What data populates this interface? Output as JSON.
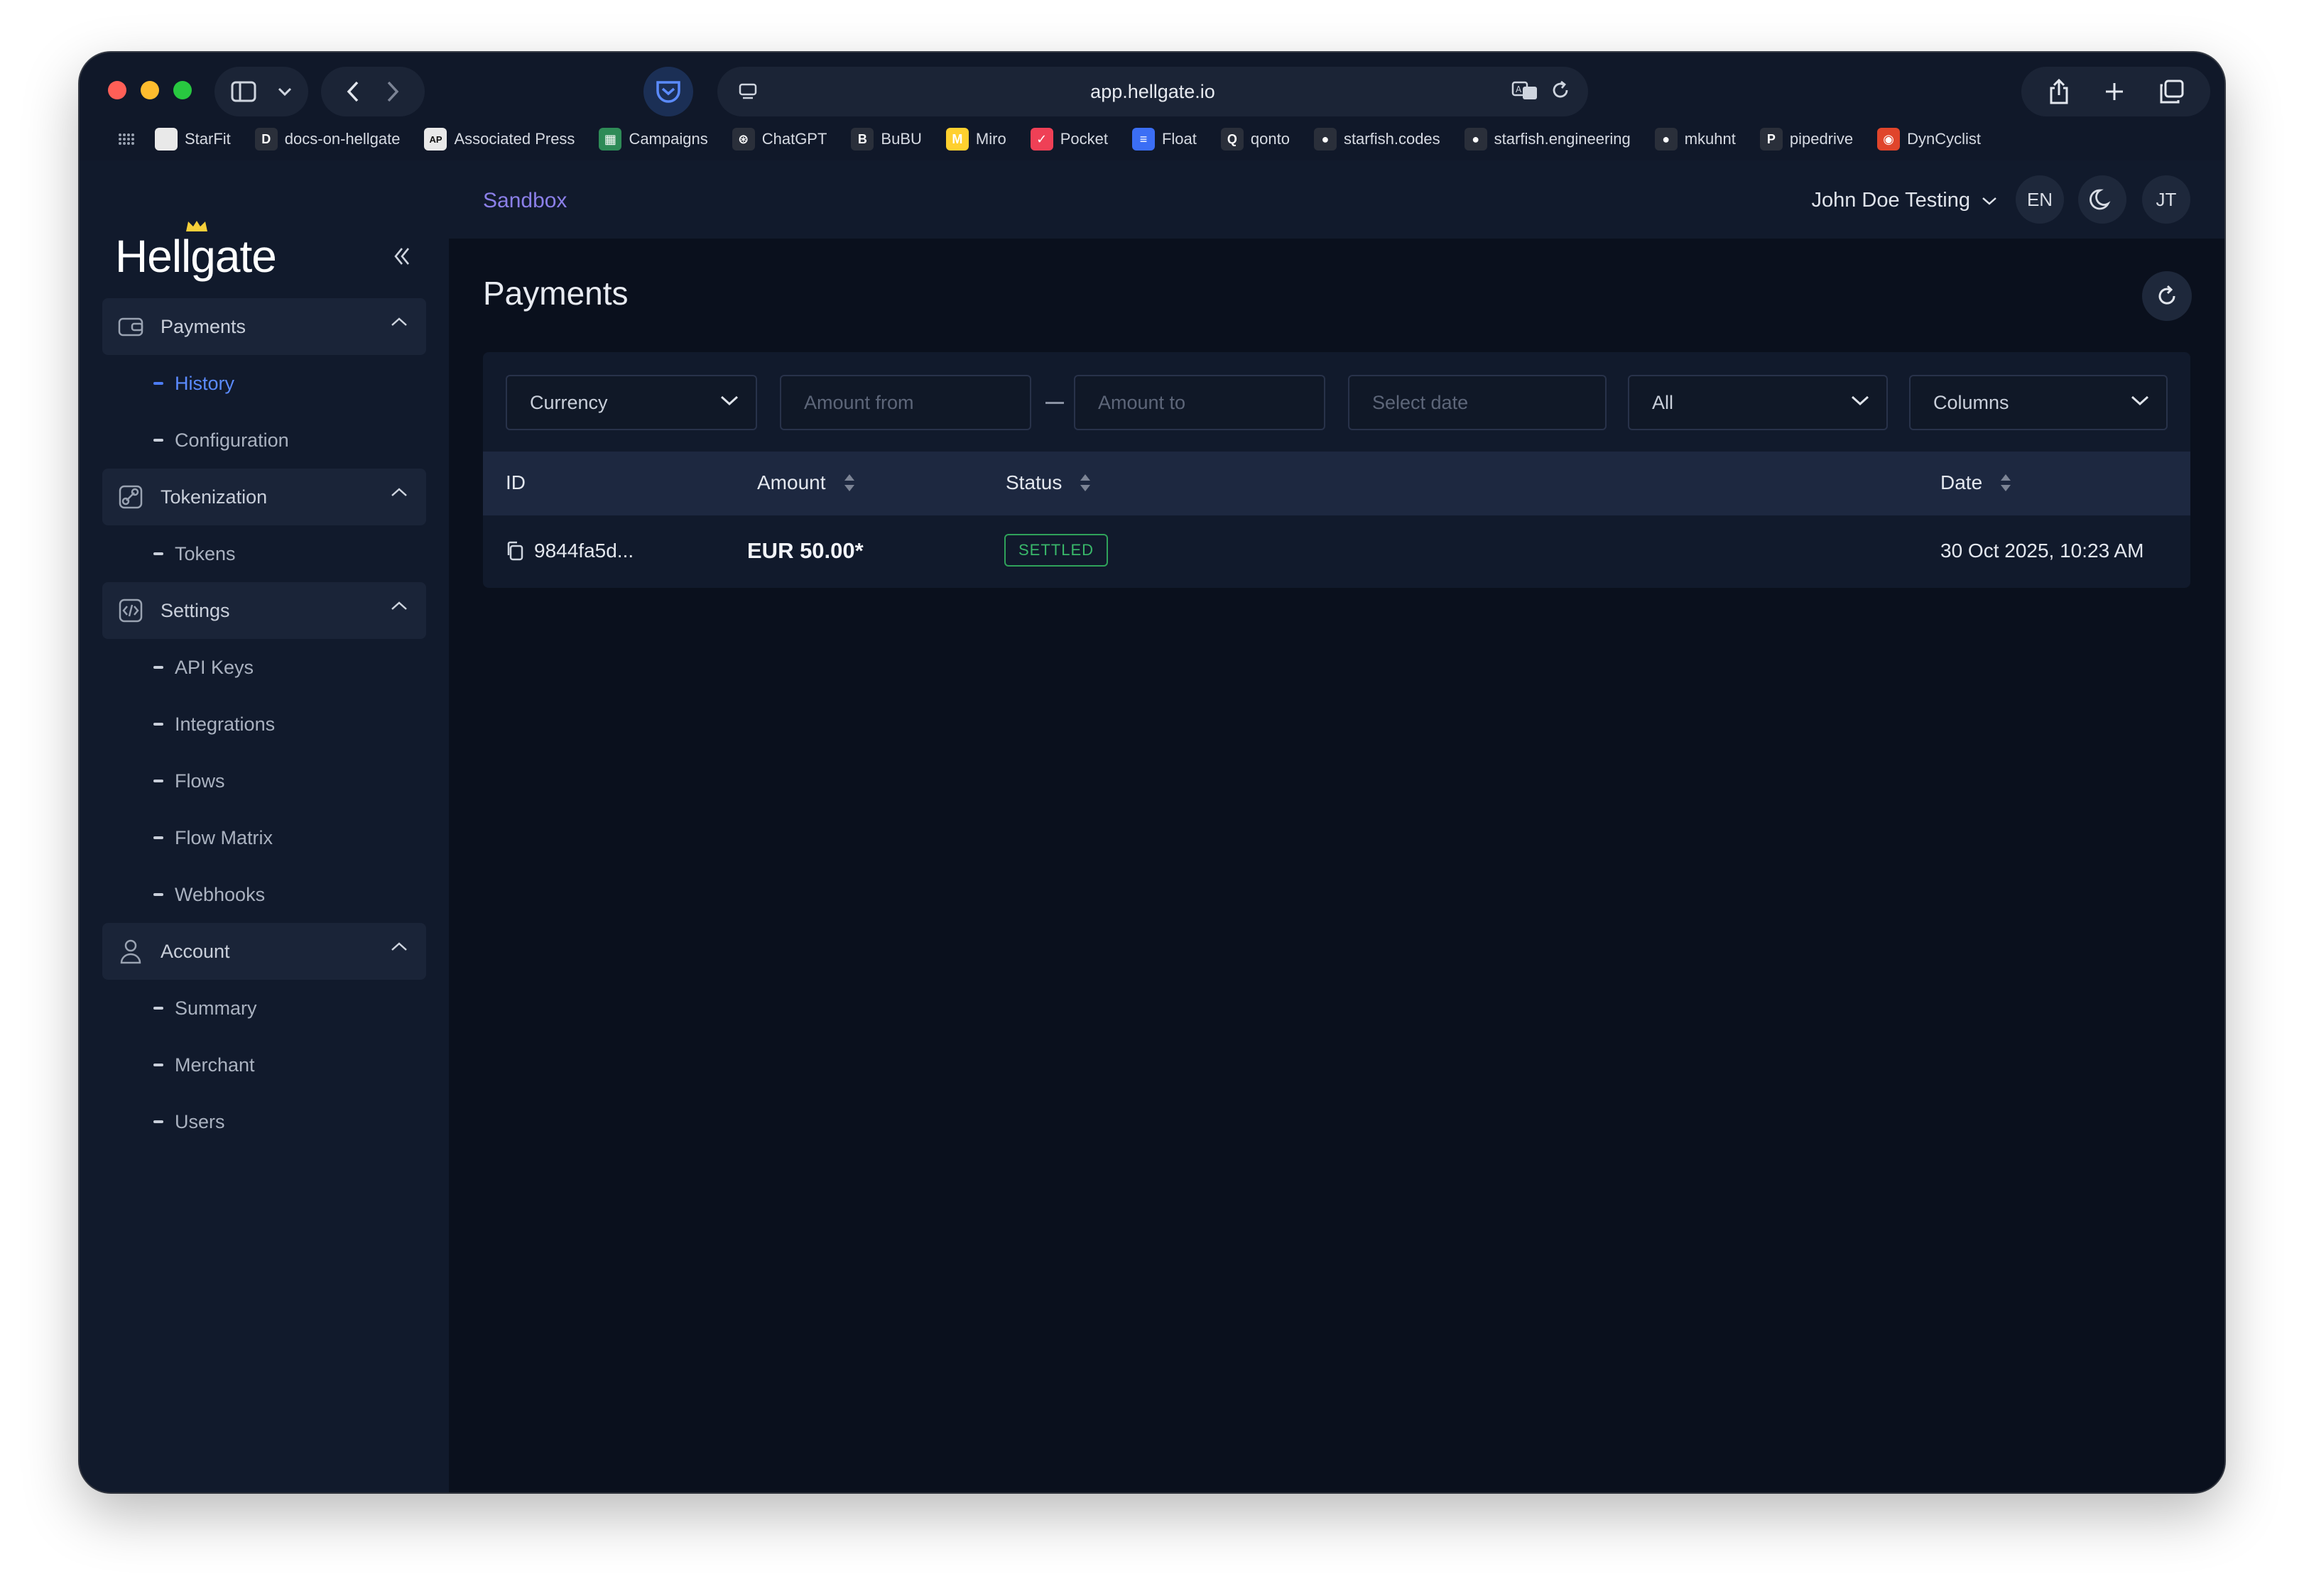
{
  "browser": {
    "url": "app.hellgate.io",
    "traffic_lights": [
      "#ff5f57",
      "#febc2e",
      "#28c840"
    ],
    "bookmarks": [
      {
        "label": "StarFit",
        "icon": "square-icon",
        "color": "#e9e9e9"
      },
      {
        "label": "docs-on-hellgate",
        "icon": "document-icon",
        "color": "#2a2f3a"
      },
      {
        "label": "Associated Press",
        "icon": "ap-icon",
        "color": "#e9e9e9"
      },
      {
        "label": "Campaigns",
        "icon": "campaigns-icon",
        "color": "#2e8b57"
      },
      {
        "label": "ChatGPT",
        "icon": "chatgpt-icon",
        "color": "#2a2f3a"
      },
      {
        "label": "BuBU",
        "icon": "bubu-icon",
        "color": "#2a2f3a"
      },
      {
        "label": "Miro",
        "icon": "miro-icon",
        "color": "#ffd02f"
      },
      {
        "label": "Pocket",
        "icon": "pocket-icon",
        "color": "#ef4056"
      },
      {
        "label": "Float",
        "icon": "float-icon",
        "color": "#3b6ef5"
      },
      {
        "label": "qonto",
        "icon": "qonto-icon",
        "color": "#2a2f3a"
      },
      {
        "label": "starfish.codes",
        "icon": "github-icon",
        "color": "#2a2f3a"
      },
      {
        "label": "starfish.engineering",
        "icon": "github-icon",
        "color": "#2a2f3a"
      },
      {
        "label": "mkuhnt",
        "icon": "github-icon",
        "color": "#2a2f3a"
      },
      {
        "label": "pipedrive",
        "icon": "pipedrive-icon",
        "color": "#2a2f3a"
      },
      {
        "label": "DynCyclist",
        "icon": "dyncyclist-icon",
        "color": "#e0452b"
      }
    ]
  },
  "app": {
    "logo": "Hellgate",
    "environment": "Sandbox",
    "user_name": "John Doe Testing",
    "language": "EN",
    "avatar_initials": "JT",
    "accent": "#5b8bff"
  },
  "sidebar": {
    "groups": [
      {
        "label": "Payments",
        "icon": "wallet-icon",
        "items": [
          {
            "label": "History",
            "active": true
          },
          {
            "label": "Configuration",
            "active": false
          }
        ]
      },
      {
        "label": "Tokenization",
        "icon": "link-icon",
        "items": [
          {
            "label": "Tokens",
            "active": false
          }
        ]
      },
      {
        "label": "Settings",
        "icon": "code-icon",
        "items": [
          {
            "label": "API Keys",
            "active": false
          },
          {
            "label": "Integrations",
            "active": false
          },
          {
            "label": "Flows",
            "active": false
          },
          {
            "label": "Flow Matrix",
            "active": false
          },
          {
            "label": "Webhooks",
            "active": false
          }
        ]
      },
      {
        "label": "Account",
        "icon": "user-icon",
        "items": [
          {
            "label": "Summary",
            "active": false
          },
          {
            "label": "Merchant",
            "active": false
          },
          {
            "label": "Users",
            "active": false
          }
        ]
      }
    ]
  },
  "page": {
    "title": "Payments",
    "filters": {
      "currency": "Currency",
      "amount_from_placeholder": "Amount from",
      "amount_to_placeholder": "Amount to",
      "date_placeholder": "Select date",
      "status_selected": "All",
      "columns": "Columns"
    },
    "table": {
      "columns": [
        "ID",
        "Amount",
        "Status",
        "Date"
      ],
      "rows": [
        {
          "id": "9844fa5d...",
          "amount": "EUR 50.00*",
          "status": "SETTLED",
          "date": "30 Oct 2025, 10:23 AM"
        }
      ]
    },
    "status_color": "#39b86a"
  }
}
